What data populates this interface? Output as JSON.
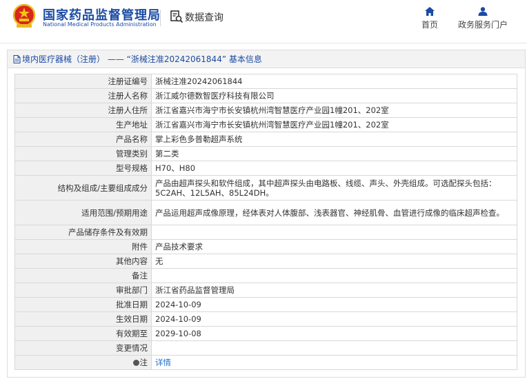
{
  "header": {
    "logo_cn": "国家药品监督管理局",
    "logo_en": "National Medical Products Administration",
    "section": "数据查询",
    "nav": [
      {
        "label": "首页",
        "icon": "home-icon"
      },
      {
        "label": "政务服务门户",
        "icon": "user-icon"
      }
    ]
  },
  "panel": {
    "title": "境内医疗器械（注册） —— “浙械注准20242061844” 基本信息"
  },
  "rows": [
    {
      "label": "注册证编号",
      "value": "浙械注准20242061844"
    },
    {
      "label": "注册人名称",
      "value": "浙江威尔德数智医疗科技有限公司"
    },
    {
      "label": "注册人住所",
      "value": "浙江省嘉兴市海宁市长安镇杭州湾智慧医疗产业园1幢201、202室"
    },
    {
      "label": "生产地址",
      "value": "浙江省嘉兴市海宁市长安镇杭州湾智慧医疗产业园1幢201、202室"
    },
    {
      "label": "产品名称",
      "value": "掌上彩色多普勒超声系统"
    },
    {
      "label": "管理类别",
      "value": "第二类"
    },
    {
      "label": "型号规格",
      "value": "H70、H80"
    },
    {
      "label": "结构及组成/主要组成成分",
      "value": "产品由超声探头和软件组成，其中超声探头由电路板、线缆、声头、外壳组成。可选配探头包括：5C2AH、12L5AH、85L24DH。"
    },
    {
      "label": "适用范围/预期用途",
      "value": "产品运用超声成像原理，经体表对人体腹部、浅表器官、神经肌骨、血管进行成像的临床超声检查。"
    },
    {
      "label": "产品储存条件及有效期",
      "value": ""
    },
    {
      "label": "附件",
      "value": "产品技术要求"
    },
    {
      "label": "其他内容",
      "value": "无"
    },
    {
      "label": "备注",
      "value": ""
    },
    {
      "label": "审批部门",
      "value": "浙江省药品监督管理局"
    },
    {
      "label": "批准日期",
      "value": "2024-10-09"
    },
    {
      "label": "生效日期",
      "value": "2024-10-09"
    },
    {
      "label": "有效期至",
      "value": "2029-10-08"
    },
    {
      "label": "变更情况",
      "value": ""
    },
    {
      "label": "注",
      "value": "详情"
    }
  ]
}
